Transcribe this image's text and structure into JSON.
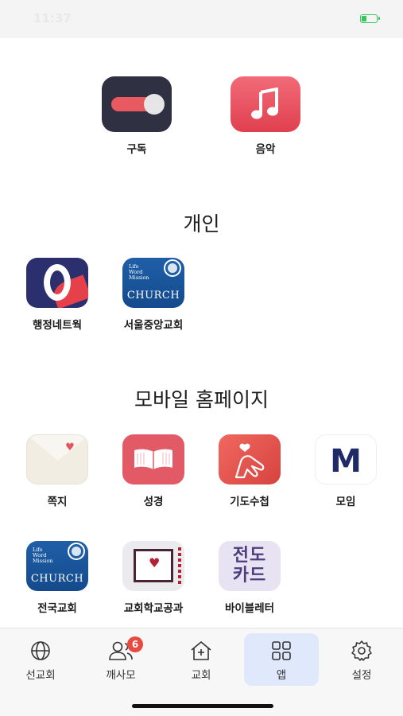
{
  "status": {
    "time": "11:37",
    "battery_level": 0.3,
    "battery_color": "#34c759"
  },
  "top_apps": [
    {
      "label": "구독",
      "icon": "toggle-switch-icon"
    },
    {
      "label": "음악",
      "icon": "music-note-icon"
    }
  ],
  "sections": [
    {
      "title": "개인",
      "apps": [
        {
          "label": "행정네트웍",
          "icon": "admin-network-logo-icon"
        },
        {
          "label": "서울중앙교회",
          "icon": "church-logo-icon",
          "tile_lines": [
            "Life",
            "Word",
            "Mission"
          ],
          "tile_word": "CHURCH"
        }
      ]
    },
    {
      "title": "모바일 홈페이지",
      "apps": [
        {
          "label": "쪽지",
          "icon": "envelope-icon"
        },
        {
          "label": "성경",
          "icon": "open-book-icon"
        },
        {
          "label": "기도수첩",
          "icon": "praying-hands-icon"
        },
        {
          "label": "모임",
          "icon": "m-logo-icon",
          "tile_text": "M"
        },
        {
          "label": "전국교회",
          "icon": "church-logo-icon",
          "tile_lines": [
            "Life",
            "Word",
            "Mission"
          ],
          "tile_word": "CHURCH"
        },
        {
          "label": "교회학교공과",
          "icon": "book-heart-icon"
        },
        {
          "label": "바이블레터",
          "icon": "evangelism-card-icon",
          "tile_text_lines": [
            "전도",
            "카드"
          ]
        }
      ]
    }
  ],
  "tabbar": {
    "tabs": [
      {
        "label": "선교회",
        "icon": "globe-icon",
        "active": false
      },
      {
        "label": "깨사모",
        "icon": "people-icon",
        "active": false,
        "badge": "6"
      },
      {
        "label": "교회",
        "icon": "church-house-icon",
        "active": false
      },
      {
        "label": "앱",
        "icon": "grid-icon",
        "active": true
      },
      {
        "label": "설정",
        "icon": "gear-icon",
        "active": false
      }
    ]
  },
  "colors": {
    "accent_tab": "#dfe9fb",
    "badge": "#e84a3f"
  }
}
